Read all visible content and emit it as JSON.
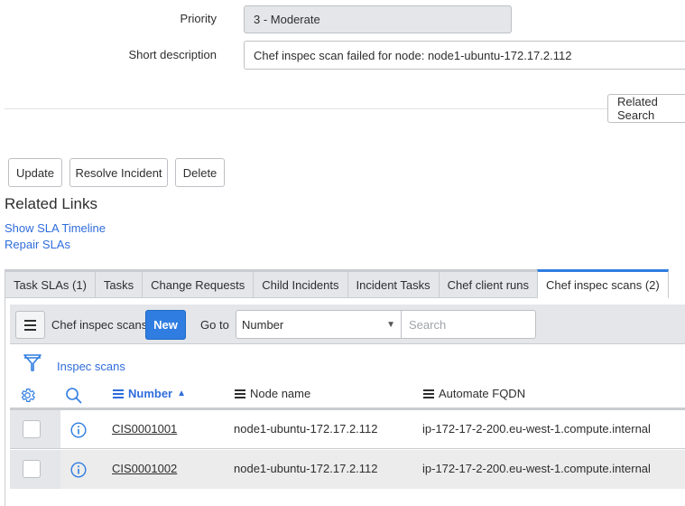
{
  "form": {
    "priority_label": "Priority",
    "priority_value": "3 - Moderate",
    "short_description_label": "Short description",
    "short_description_value": "Chef inspec scan failed for node: node1-ubuntu-172.17.2.112"
  },
  "related_search_button": "Related Search",
  "actions": {
    "update": "Update",
    "resolve_incident": "Resolve Incident",
    "delete": "Delete"
  },
  "related_links": {
    "title": "Related Links",
    "links": [
      "Show SLA Timeline",
      "Repair SLAs"
    ]
  },
  "tabs": [
    {
      "label": "Task SLAs (1)",
      "active": false
    },
    {
      "label": "Tasks",
      "active": false
    },
    {
      "label": "Change Requests",
      "active": false
    },
    {
      "label": "Child Incidents",
      "active": false
    },
    {
      "label": "Incident Tasks",
      "active": false
    },
    {
      "label": "Chef client runs",
      "active": false
    },
    {
      "label": "Chef inspec scans (2)",
      "active": true
    }
  ],
  "list": {
    "title": "Chef inspec scans",
    "new_label": "New",
    "goto_label": "Go to",
    "goto_selected": "Number",
    "search_placeholder": "Search",
    "filter_breadcrumb": "Inspec scans",
    "columns": {
      "number": "Number",
      "node_name": "Node name",
      "automate_fqdn": "Automate FQDN"
    },
    "sort_indicator": "▲",
    "rows": [
      {
        "number": "CIS0001001",
        "node_name": "node1-ubuntu-172.17.2.112",
        "automate_fqdn": "ip-172-17-2-200.eu-west-1.compute.internal"
      },
      {
        "number": "CIS0001002",
        "node_name": "node1-ubuntu-172.17.2.112",
        "automate_fqdn": "ip-172-17-2-200.eu-west-1.compute.internal"
      }
    ]
  },
  "colors": {
    "accent": "#2f7de1",
    "link": "#2f6ddb",
    "readonly_bg": "#e4e6e9"
  }
}
